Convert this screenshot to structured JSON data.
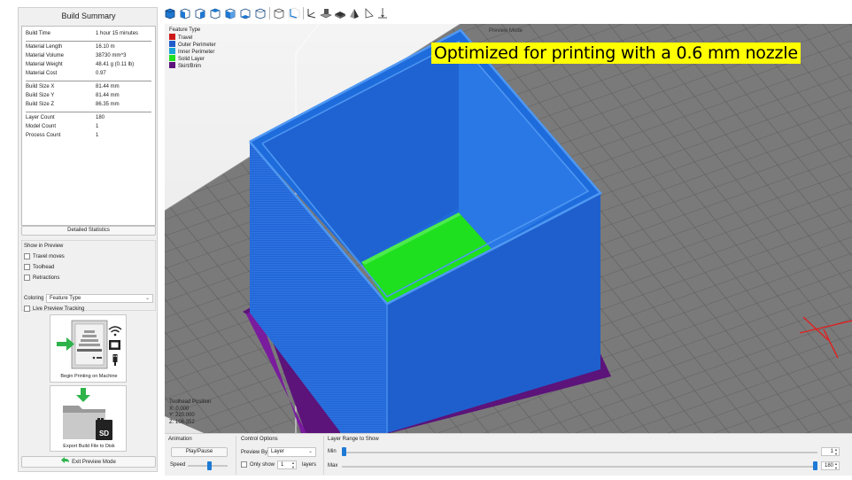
{
  "build_summary": {
    "title": "Build Summary",
    "stats": [
      {
        "label": "Build Time",
        "value": "1 hour 15 minutes"
      },
      {
        "label": "Material Length",
        "value": "16.10 m"
      },
      {
        "label": "Material Volume",
        "value": "38730 mm^3"
      },
      {
        "label": "Material Weight",
        "value": "48.41 g (0.11 lb)"
      },
      {
        "label": "Material Cost",
        "value": "0.97"
      },
      {
        "label": "Build Size X",
        "value": "81.44 mm"
      },
      {
        "label": "Build Size Y",
        "value": "81.44 mm"
      },
      {
        "label": "Build Size Z",
        "value": "86.35 mm"
      },
      {
        "label": "Layer Count",
        "value": "180"
      },
      {
        "label": "Model Count",
        "value": "1"
      },
      {
        "label": "Process Count",
        "value": "1"
      }
    ],
    "detailed_button": "Detailed Statistics"
  },
  "show_in_preview": {
    "title": "Show in Preview",
    "options": [
      "Travel moves",
      "Toolhead",
      "Retractions"
    ],
    "coloring_label": "Coloring",
    "coloring_value": "Feature Type",
    "live_tracking": "Live Preview Tracking"
  },
  "actions": {
    "print_label": "Begin Printing on Machine",
    "export_label": "Export Build File to Disk",
    "exit_label": "Exit Preview Mode",
    "sd_text": "SD"
  },
  "viewport": {
    "legend_title": "Feature Type",
    "legend": [
      {
        "label": "Travel",
        "color": "#cc1a1a"
      },
      {
        "label": "Outer Perimeter",
        "color": "#1f5cc9"
      },
      {
        "label": "Inner Perimeter",
        "color": "#1aa3d6"
      },
      {
        "label": "Solid Layer",
        "color": "#1fe01f"
      },
      {
        "label": "Skirt/Brim",
        "color": "#5c137a"
      }
    ],
    "mode_label": "Preview Mode",
    "annotation": "Optimized for printing with a 0.6 mm nozzle",
    "toolhead": {
      "title": "Toolhead Position",
      "x": "X: 0.000",
      "y": "Y: 220.000",
      "z": "Z: 106.352"
    }
  },
  "toolbar": {
    "icons": [
      "iso-view-icon",
      "front-view-icon",
      "back-view-icon",
      "left-view-icon",
      "right-view-icon",
      "top-view-icon",
      "bottom-view-icon",
      "perspective-icon",
      "axes-icon",
      "build-plate-icon",
      "shaded-icon",
      "section-icon",
      "measure-icon",
      "toolhead-icon"
    ]
  },
  "controls": {
    "animation_title": "Animation",
    "play_label": "Play/Pause",
    "speed_label": "Speed",
    "control_title": "Control Options",
    "preview_by_label": "Preview By",
    "preview_by_value": "Layer",
    "only_show_label": "Only show",
    "only_show_value": "1",
    "layers_label": "layers",
    "range_title": "Layer Range to Show",
    "min_label": "Min",
    "min_value": "1",
    "max_label": "Max",
    "max_value": "180",
    "layer_range": [
      1,
      180
    ],
    "layer_count": 180,
    "speed_fraction": 0.55
  },
  "colors": {
    "outer_perimeter": "#1f5cc9",
    "solid_layer": "#1fe01f",
    "skirt": "#5c137a",
    "accent": "#1e7ad6",
    "annotation_bg": "#ffff00"
  }
}
